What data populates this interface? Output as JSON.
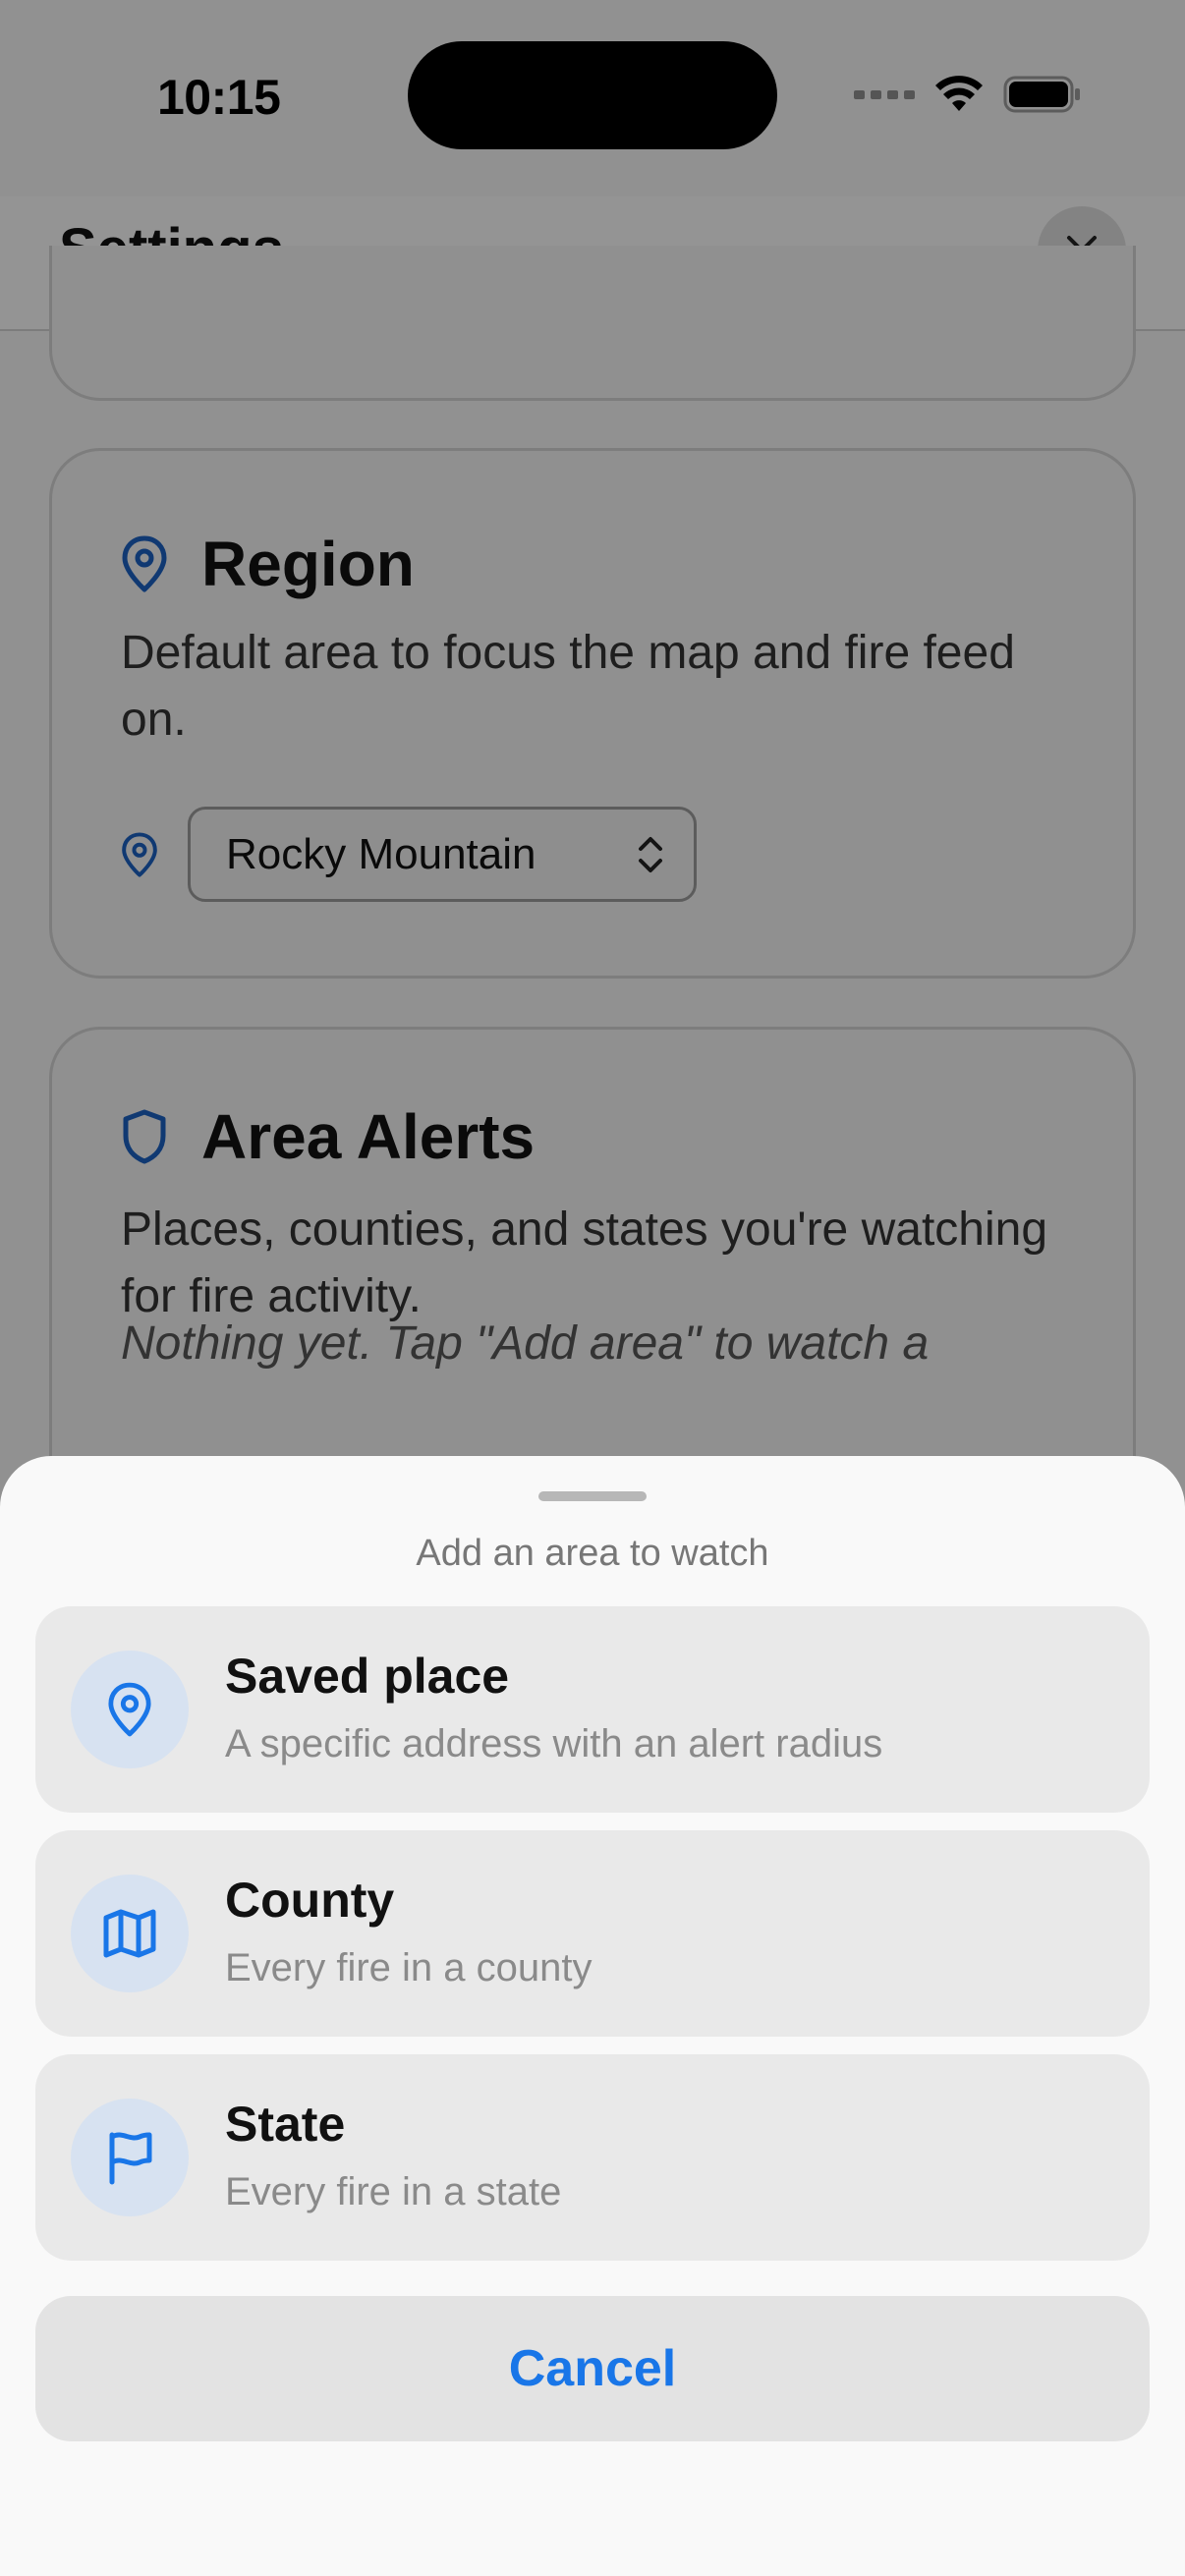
{
  "status_bar": {
    "time": "10:15"
  },
  "nav": {
    "title": "Settings"
  },
  "region_card": {
    "title": "Region",
    "description": "Default area to focus the map and fire feed on.",
    "selected_region": "Rocky Mountain"
  },
  "alerts_card": {
    "title": "Area Alerts",
    "description": "Places, counties, and states you're watching for fire activity.",
    "empty_note": "Nothing yet. Tap \"Add area\" to watch a"
  },
  "sheet": {
    "title": "Add an area to watch",
    "options": [
      {
        "title": "Saved place",
        "subtitle": "A specific address with an alert radius",
        "icon": "map-pin-icon"
      },
      {
        "title": "County",
        "subtitle": "Every fire in a county",
        "icon": "map-icon"
      },
      {
        "title": "State",
        "subtitle": "Every fire in a state",
        "icon": "flag-icon"
      }
    ],
    "cancel_label": "Cancel"
  },
  "colors": {
    "accent": "#1976e8",
    "icon_bg": "#d7e2f1",
    "region_icon": "#1b5fbf"
  }
}
